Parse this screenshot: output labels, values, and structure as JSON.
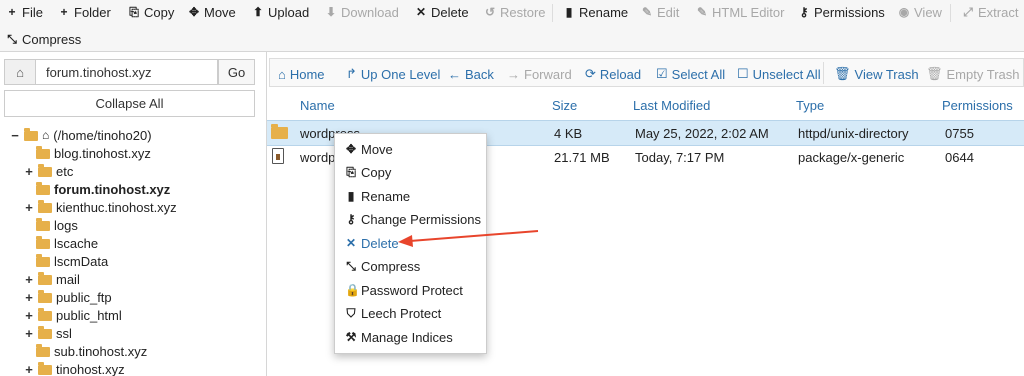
{
  "toolbar": {
    "file": "File",
    "folder": "Folder",
    "copy": "Copy",
    "move": "Move",
    "upload": "Upload",
    "download": "Download",
    "delete": "Delete",
    "restore": "Restore",
    "rename": "Rename",
    "edit": "Edit",
    "html_editor": "HTML Editor",
    "permissions": "Permissions",
    "view": "View",
    "extract": "Extract",
    "compress": "Compress"
  },
  "left": {
    "path_value": "forum.tinohost.xyz",
    "go_label": "Go",
    "collapse_label": "Collapse All",
    "tree": [
      {
        "toggle": "−",
        "label": "(/home/tinoho20)",
        "root": true
      },
      {
        "toggle": "",
        "label": "blog.tinohost.xyz"
      },
      {
        "toggle": "+",
        "label": "etc"
      },
      {
        "toggle": "",
        "label": "forum.tinohost.xyz",
        "bold": true
      },
      {
        "toggle": "+",
        "label": "kienthuc.tinohost.xyz"
      },
      {
        "toggle": "",
        "label": "logs"
      },
      {
        "toggle": "",
        "label": "lscache"
      },
      {
        "toggle": "",
        "label": "lscmData"
      },
      {
        "toggle": "+",
        "label": "mail"
      },
      {
        "toggle": "+",
        "label": "public_ftp"
      },
      {
        "toggle": "+",
        "label": "public_html"
      },
      {
        "toggle": "+",
        "label": "ssl"
      },
      {
        "toggle": "",
        "label": "sub.tinohost.xyz"
      },
      {
        "toggle": "+",
        "label": "tinohost.xyz"
      }
    ]
  },
  "nav": {
    "home": "Home",
    "up": "Up One Level",
    "back": "Back",
    "forward": "Forward",
    "reload": "Reload",
    "select_all": "Select All",
    "unselect_all": "Unselect All",
    "view_trash": "View Trash",
    "empty_trash": "Empty Trash"
  },
  "table": {
    "headers": [
      "Name",
      "Size",
      "Last Modified",
      "Type",
      "Permissions"
    ],
    "rows": [
      {
        "name": "wordpress",
        "size": "4 KB",
        "modified": "May 25, 2022, 2:02 AM",
        "type": "httpd/unix-directory",
        "perms": "0755"
      },
      {
        "name": "wordpr",
        "size": "21.71 MB",
        "modified": "Today, 7:17 PM",
        "type": "package/x-generic",
        "perms": "0644"
      }
    ]
  },
  "context_menu": {
    "items": [
      "Move",
      "Copy",
      "Rename",
      "Change Permissions",
      "Delete",
      "Compress",
      "Password Protect",
      "Leech Protect",
      "Manage Indices"
    ]
  },
  "colors": {
    "link_blue": "#2c6faa",
    "folder": "#e6b04a",
    "arrow": "#e8452c",
    "selected_row": "#d6eaf8"
  }
}
